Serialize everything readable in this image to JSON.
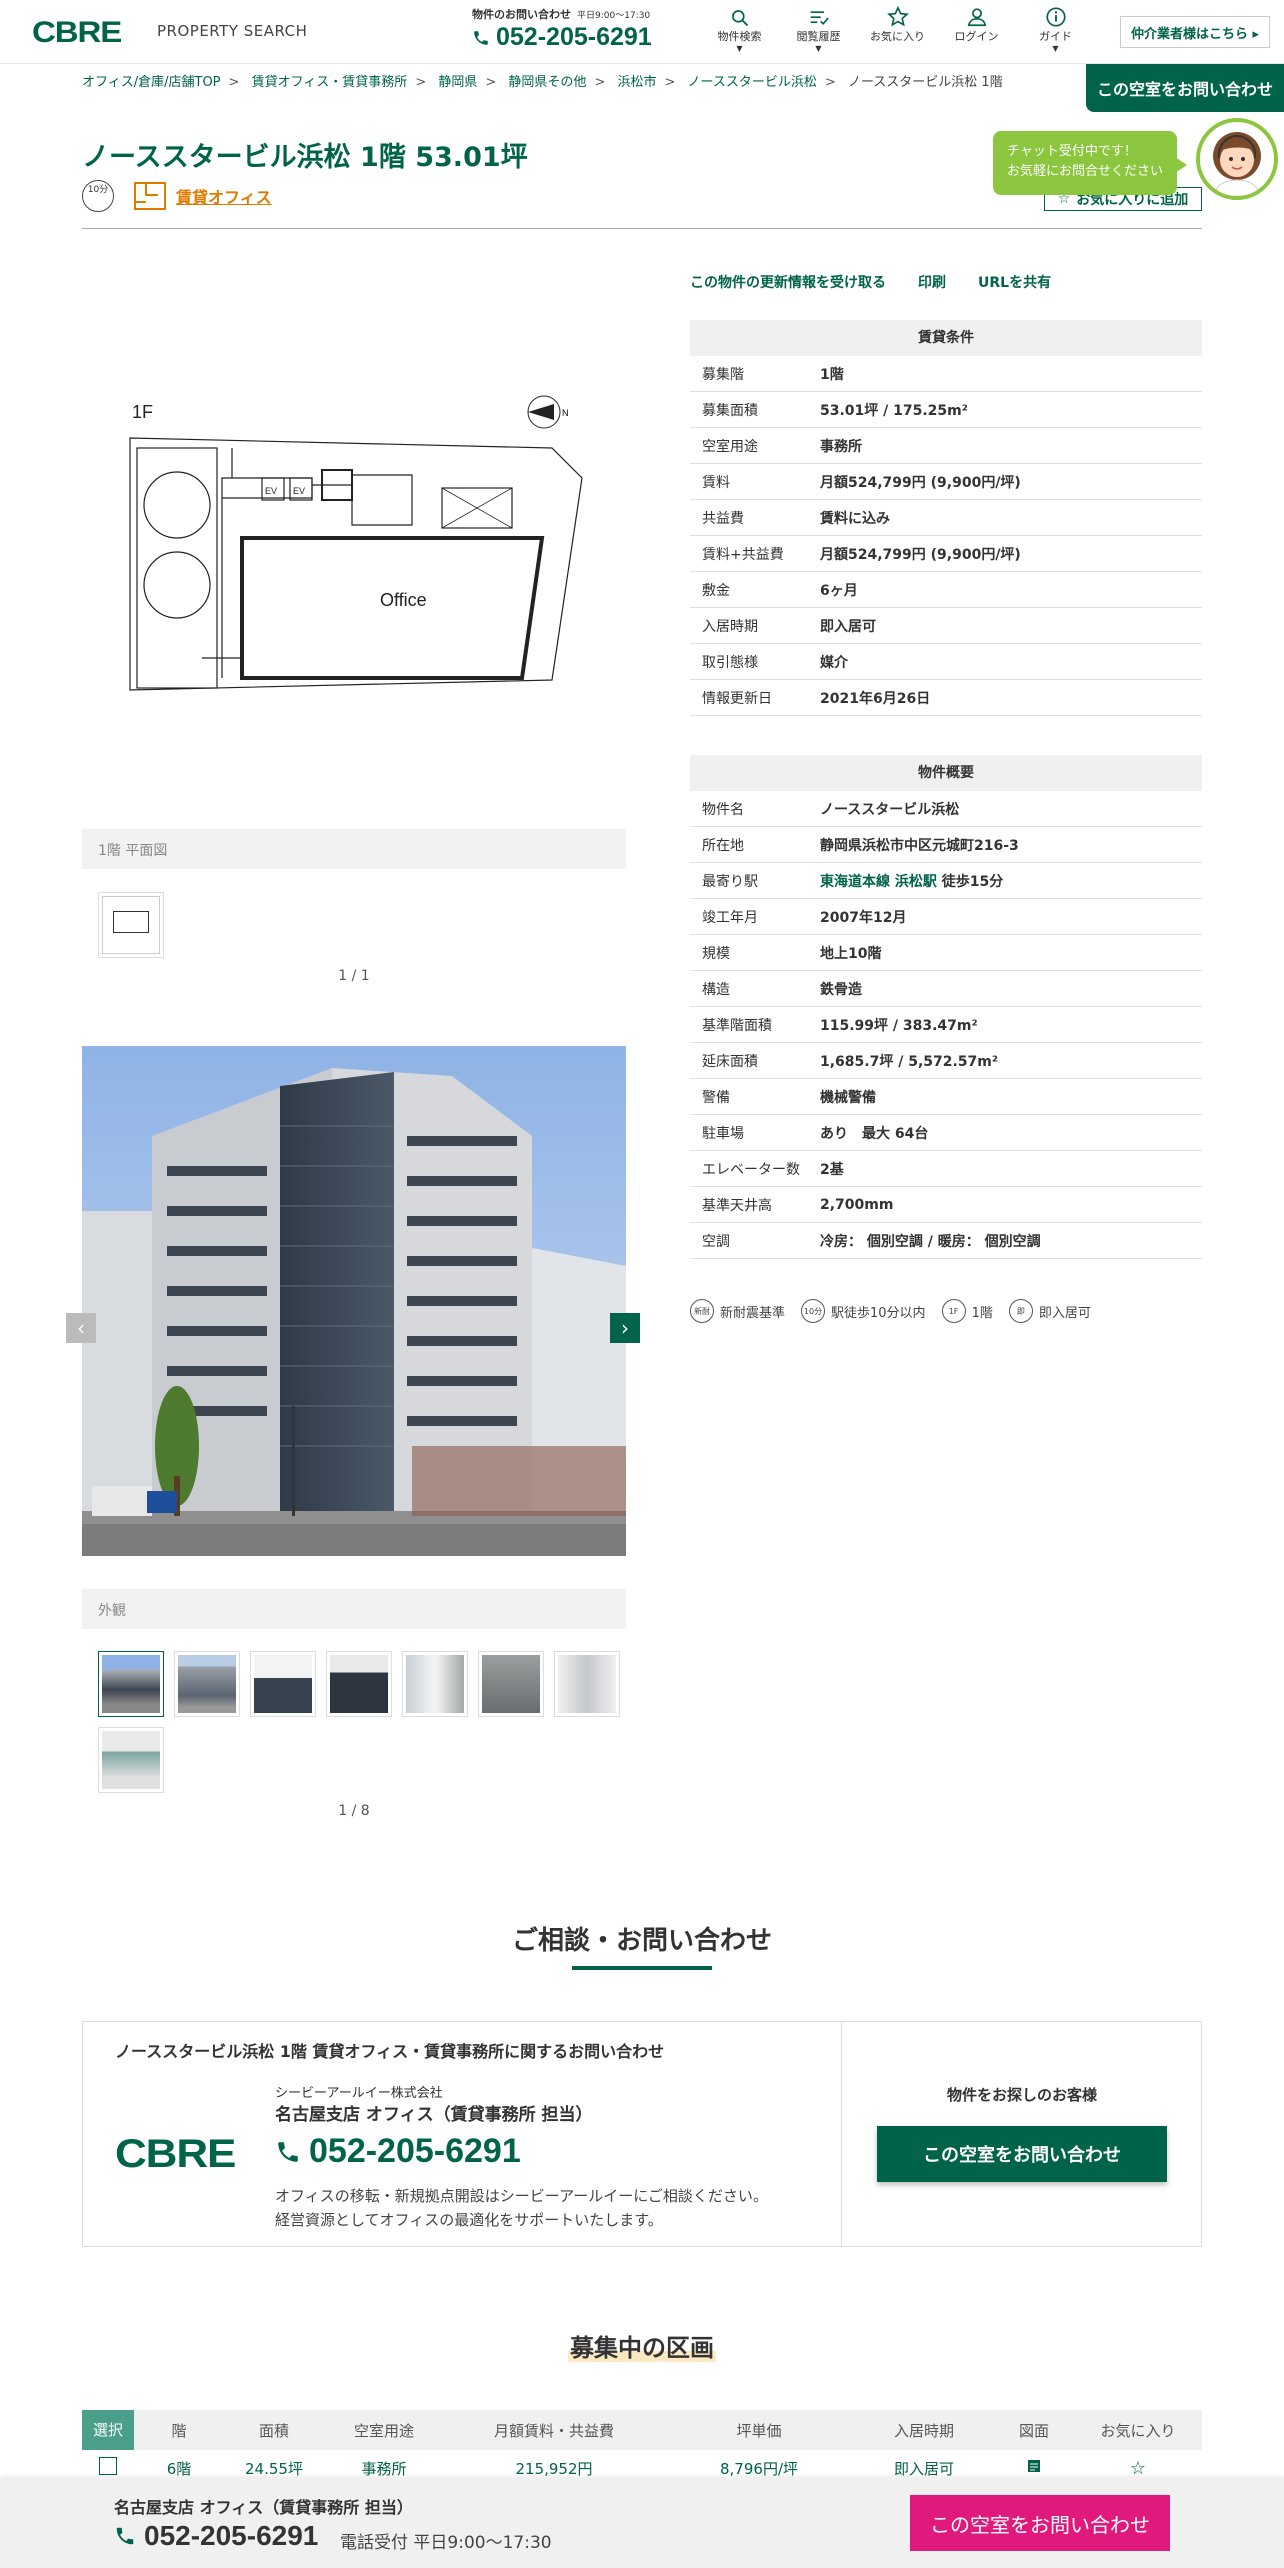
{
  "header": {
    "logo": "CBRE",
    "brand_sub": "PROPERTY SEARCH",
    "contact_label": "物件のお問い合わせ",
    "contact_hours": "平日9:00〜17:30",
    "phone": "052-205-6291",
    "nav": [
      {
        "label": "物件検索",
        "icon": "search-icon"
      },
      {
        "label": "閲覧履歴",
        "icon": "history-icon"
      },
      {
        "label": "お気に入り",
        "icon": "star-icon"
      },
      {
        "label": "ログイン",
        "icon": "user-icon"
      },
      {
        "label": "ガイド",
        "icon": "info-icon"
      }
    ],
    "broker_button": "仲介業者様はこちら ▸"
  },
  "breadcrumb": [
    "オフィス/倉庫/店舗TOP",
    "賃貸オフィス・賃貸事務所",
    "静岡県",
    "静岡県その他",
    "浜松市",
    "ノーススタービル浜松",
    "ノーススタービル浜松 1階"
  ],
  "inquiry_tab": "この空室をお問い合わせ",
  "property": {
    "title": "ノーススタービル浜松 1階 53.01坪",
    "walk_badge": "10分",
    "type_tag": "賃貸オフィス",
    "favorite_button": "お気に入りに追加",
    "chat_bubble": [
      "チャット受付中です！",
      "お気軽にお問合せください"
    ]
  },
  "floorplan": {
    "caption": "1階 平面図",
    "pager": "1 / 1",
    "labels": {
      "floor": "1F",
      "office": "Office",
      "ev": "EV",
      "north": "N"
    }
  },
  "gallery": {
    "caption": "外観",
    "pager": "1 / 8",
    "prev": "‹",
    "next": "›"
  },
  "actions": [
    "この物件の更新情報を受け取る",
    "印刷",
    "URLを共有"
  ],
  "lease_terms": {
    "heading": "賃貸条件",
    "rows": [
      {
        "k": "募集階",
        "v": "1階"
      },
      {
        "k": "募集面積",
        "v": "53.01坪 / 175.25m²"
      },
      {
        "k": "空室用途",
        "v": "事務所"
      },
      {
        "k": "賃料",
        "v": "月額524,799円 (9,900円/坪)"
      },
      {
        "k": "共益費",
        "v": "賃料に込み"
      },
      {
        "k": "賃料+共益費",
        "v": "月額524,799円 (9,900円/坪)"
      },
      {
        "k": "敷金",
        "v": "6ヶ月"
      },
      {
        "k": "入居時期",
        "v": "即入居可"
      },
      {
        "k": "取引態様",
        "v": "媒介"
      },
      {
        "k": "情報更新日",
        "v": "2021年6月26日"
      }
    ]
  },
  "overview": {
    "heading": "物件概要",
    "rows": [
      {
        "k": "物件名",
        "v": "ノーススタービル浜松"
      },
      {
        "k": "所在地",
        "v": "静岡県浜松市中区元城町216-3"
      },
      {
        "k": "最寄り駅",
        "v": "徒歩15分",
        "link": "東海道本線 浜松駅"
      },
      {
        "k": "竣工年月",
        "v": "2007年12月"
      },
      {
        "k": "規模",
        "v": "地上10階"
      },
      {
        "k": "構造",
        "v": "鉄骨造"
      },
      {
        "k": "基準階面積",
        "v": "115.99坪 / 383.47m²"
      },
      {
        "k": "延床面積",
        "v": "1,685.7坪 / 5,572.57m²"
      },
      {
        "k": "警備",
        "v": "機械警備"
      },
      {
        "k": "駐車場",
        "v": "あり　最大 64台"
      },
      {
        "k": "エレベーター数",
        "v": "2基"
      },
      {
        "k": "基準天井高",
        "v": "2,700mm"
      },
      {
        "k": "空調",
        "v": "冷房： 個別空調 / 暖房： 個別空調"
      }
    ]
  },
  "features": [
    {
      "icon": "新耐",
      "label": "新耐震基準"
    },
    {
      "icon": "10分",
      "label": "駅徒歩10分以内"
    },
    {
      "icon": "1F",
      "label": "1階"
    },
    {
      "icon": "即",
      "label": "即入居可"
    }
  ],
  "consult": {
    "heading": "ご相談・お問い合わせ",
    "subject": "ノーススタービル浜松 1階 賃貸オフィス・賃貸事務所に関するお問い合わせ",
    "logo": "CBRE",
    "company": "シービーアールイー株式会社",
    "branch": "名古屋支店 オフィス（賃貸事務所 担当）",
    "phone": "052-205-6291",
    "desc1": "オフィスの移転・新規拠点開設はシービーアールイーにご相談ください。",
    "desc2": "経営資源としてオフィスの最適化をサポートいたします。",
    "right_label": "物件をお探しのお客様",
    "button": "この空室をお問い合わせ"
  },
  "vacancies": {
    "heading": "募集中の区画",
    "columns": [
      "選択",
      "階",
      "面積",
      "空室用途",
      "月額賃料・共益費",
      "坪単価",
      "入居時期",
      "図面",
      "お気に入り"
    ],
    "rows": [
      {
        "floor": "6階",
        "area": "24.55坪",
        "use": "事務所",
        "rent": "215,952円",
        "unit": "8,796円/坪",
        "move": "即入居可"
      }
    ]
  },
  "footer": {
    "branch": "名古屋支店 オフィス（賃貸事務所 担当）",
    "phone": "052-205-6291",
    "hours": "電話受付 平日9:00〜17:30",
    "button": "この空室をお問い合わせ"
  }
}
